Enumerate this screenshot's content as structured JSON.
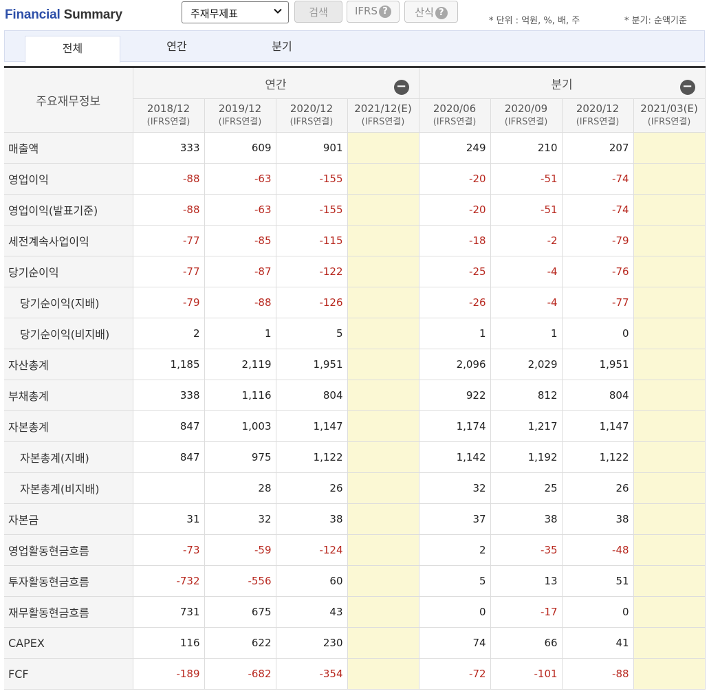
{
  "header": {
    "title_part1": "Financial",
    "title_part2": "Summary",
    "select_value": "주재무제표",
    "search_label": "검색",
    "ifrs_label": "IFRS",
    "formula_label": "산식",
    "help_symbol": "?",
    "unit_note": "* 단위 : 억원, %, 배, 주",
    "quarter_note": "* 분기: 순액기준"
  },
  "tabs": [
    {
      "label": "전체",
      "active": true
    },
    {
      "label": "연간",
      "active": false
    },
    {
      "label": "분기",
      "active": false
    }
  ],
  "table": {
    "corner_label": "주요재무정보",
    "annual_group": "연간",
    "quarter_group": "분기",
    "collapse_symbol": "−",
    "columns": [
      {
        "period": "2018/12",
        "sub": "(IFRS연결)",
        "estimate": false
      },
      {
        "period": "2019/12",
        "sub": "(IFRS연결)",
        "estimate": false
      },
      {
        "period": "2020/12",
        "sub": "(IFRS연결)",
        "estimate": false
      },
      {
        "period": "2021/12(E)",
        "sub": "(IFRS연결)",
        "estimate": true
      },
      {
        "period": "2020/06",
        "sub": "(IFRS연결)",
        "estimate": false
      },
      {
        "period": "2020/09",
        "sub": "(IFRS연결)",
        "estimate": false
      },
      {
        "period": "2020/12",
        "sub": "(IFRS연결)",
        "estimate": false
      },
      {
        "period": "2021/03(E)",
        "sub": "(IFRS연결)",
        "estimate": true
      }
    ],
    "rows": [
      {
        "label": "매출액",
        "indent": false,
        "values": [
          "333",
          "609",
          "901",
          "",
          "249",
          "210",
          "207",
          ""
        ]
      },
      {
        "label": "영업이익",
        "indent": false,
        "values": [
          "-88",
          "-63",
          "-155",
          "",
          "-20",
          "-51",
          "-74",
          ""
        ]
      },
      {
        "label": "영업이익(발표기준)",
        "indent": false,
        "values": [
          "-88",
          "-63",
          "-155",
          "",
          "-20",
          "-51",
          "-74",
          ""
        ]
      },
      {
        "label": "세전계속사업이익",
        "indent": false,
        "values": [
          "-77",
          "-85",
          "-115",
          "",
          "-18",
          "-2",
          "-79",
          ""
        ]
      },
      {
        "label": "당기순이익",
        "indent": false,
        "values": [
          "-77",
          "-87",
          "-122",
          "",
          "-25",
          "-4",
          "-76",
          ""
        ]
      },
      {
        "label": "당기순이익(지배)",
        "indent": true,
        "values": [
          "-79",
          "-88",
          "-126",
          "",
          "-26",
          "-4",
          "-77",
          ""
        ]
      },
      {
        "label": "당기순이익(비지배)",
        "indent": true,
        "values": [
          "2",
          "1",
          "5",
          "",
          "1",
          "1",
          "0",
          ""
        ]
      },
      {
        "label": "자산총계",
        "indent": false,
        "values": [
          "1,185",
          "2,119",
          "1,951",
          "",
          "2,096",
          "2,029",
          "1,951",
          ""
        ]
      },
      {
        "label": "부채총계",
        "indent": false,
        "values": [
          "338",
          "1,116",
          "804",
          "",
          "922",
          "812",
          "804",
          ""
        ]
      },
      {
        "label": "자본총계",
        "indent": false,
        "values": [
          "847",
          "1,003",
          "1,147",
          "",
          "1,174",
          "1,217",
          "1,147",
          ""
        ]
      },
      {
        "label": "자본총계(지배)",
        "indent": true,
        "values": [
          "847",
          "975",
          "1,122",
          "",
          "1,142",
          "1,192",
          "1,122",
          ""
        ]
      },
      {
        "label": "자본총계(비지배)",
        "indent": true,
        "values": [
          "",
          "28",
          "26",
          "",
          "32",
          "25",
          "26",
          ""
        ]
      },
      {
        "label": "자본금",
        "indent": false,
        "values": [
          "31",
          "32",
          "38",
          "",
          "37",
          "38",
          "38",
          ""
        ]
      },
      {
        "label": "영업활동현금흐름",
        "indent": false,
        "values": [
          "-73",
          "-59",
          "-124",
          "",
          "2",
          "-35",
          "-48",
          ""
        ]
      },
      {
        "label": "투자활동현금흐름",
        "indent": false,
        "values": [
          "-732",
          "-556",
          "60",
          "",
          "5",
          "13",
          "51",
          ""
        ]
      },
      {
        "label": "재무활동현금흐름",
        "indent": false,
        "values": [
          "731",
          "675",
          "43",
          "",
          "0",
          "-17",
          "0",
          ""
        ]
      },
      {
        "label": "CAPEX",
        "indent": false,
        "values": [
          "116",
          "622",
          "230",
          "",
          "74",
          "66",
          "41",
          ""
        ]
      },
      {
        "label": "FCF",
        "indent": false,
        "values": [
          "-189",
          "-682",
          "-354",
          "",
          "-72",
          "-101",
          "-88",
          ""
        ]
      }
    ]
  }
}
